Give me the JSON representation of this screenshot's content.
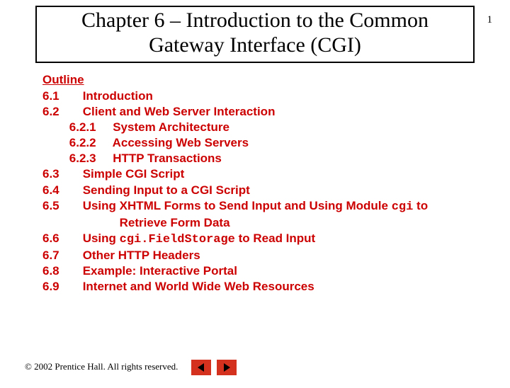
{
  "pageNumber": "1",
  "title": "Chapter 6 – Introduction to the Common Gateway Interface (CGI)",
  "outlineHeading": "Outline",
  "outline": [
    {
      "num": "6.1",
      "indent": 0,
      "text": "Introduction"
    },
    {
      "num": "6.2",
      "indent": 0,
      "text": "Client and Web Server Interaction"
    },
    {
      "num": "6.2.1",
      "indent": 1,
      "text": "System Architecture"
    },
    {
      "num": "6.2.2",
      "indent": 1,
      "text": "Accessing Web Servers"
    },
    {
      "num": "6.2.3",
      "indent": 1,
      "text": "HTTP Transactions"
    },
    {
      "num": "6.3",
      "indent": 0,
      "text": "Simple CGI Script"
    },
    {
      "num": "6.4",
      "indent": 0,
      "text": "Sending Input to a CGI Script"
    },
    {
      "num": "6.5",
      "indent": 0,
      "parts": [
        {
          "t": "Using XHTML Forms to Send Input and Using Module "
        },
        {
          "t": "cgi",
          "code": true
        },
        {
          "t": " to"
        }
      ],
      "cont": "Retrieve Form Data"
    },
    {
      "num": "6.6",
      "indent": 0,
      "parts": [
        {
          "t": "Using "
        },
        {
          "t": "cgi.FieldStorage",
          "code": true
        },
        {
          "t": " to Read Input"
        }
      ]
    },
    {
      "num": "6.7",
      "indent": 0,
      "text": "Other HTTP Headers"
    },
    {
      "num": "6.8",
      "indent": 0,
      "text": "Example: Interactive Portal"
    },
    {
      "num": "6.9",
      "indent": 0,
      "text": "Internet and World Wide Web Resources"
    }
  ],
  "copyright": "© 2002 Prentice Hall.  All rights reserved."
}
